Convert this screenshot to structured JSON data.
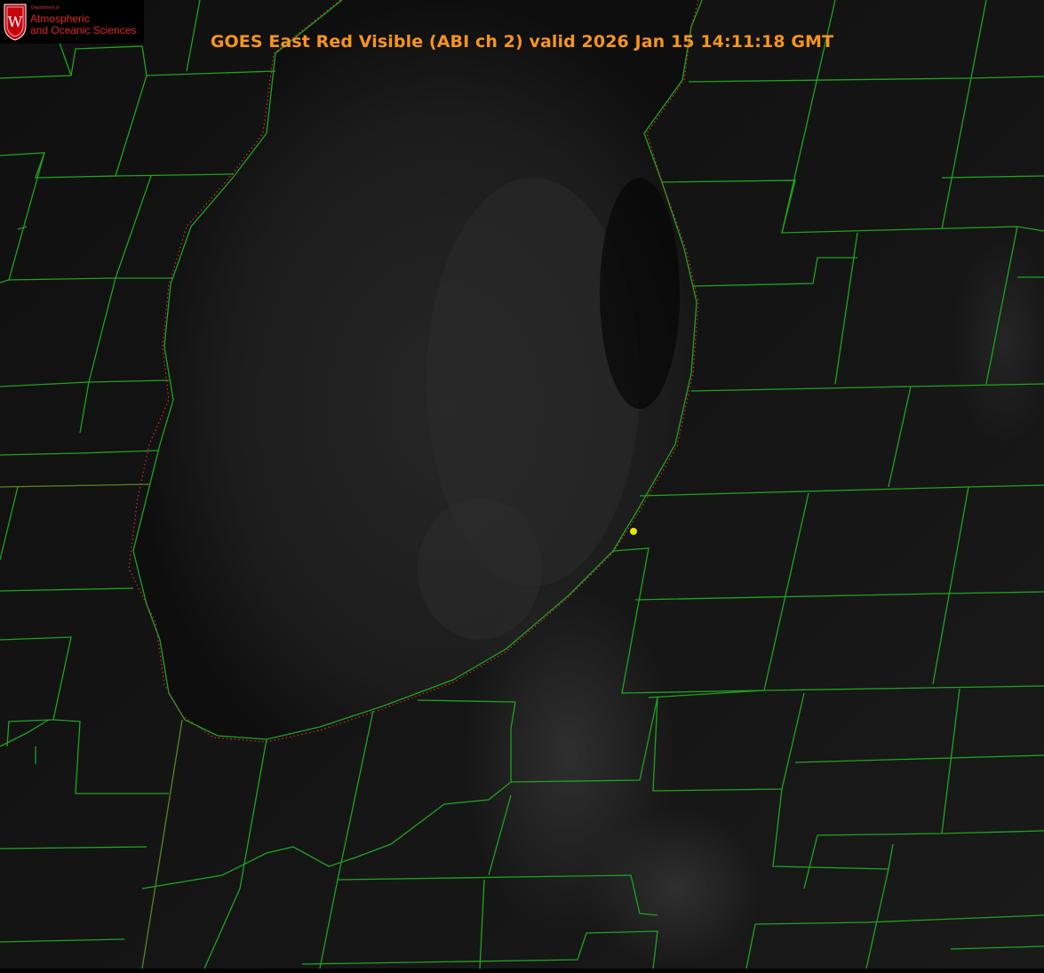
{
  "title": "GOES East Red Visible (ABI ch 2) valid 2026 Jan 15 14:11:18 GMT",
  "logo": {
    "dept": "Department of",
    "line1": "Atmospheric",
    "line2": "and Oceanic Sciences",
    "crest_letter": "W"
  },
  "colors": {
    "title": "#f7941d",
    "county_lines": "#1fa31f",
    "coastline_dotted": "#e03030",
    "marker": "#e6e600",
    "logo_text": "#e0282c",
    "logo_crest": "#c5050c"
  },
  "map": {
    "imagery": "visible satellite, grayscale",
    "feature": "Lake Michigan (southern basin)",
    "marker_icon": "station-dot"
  }
}
